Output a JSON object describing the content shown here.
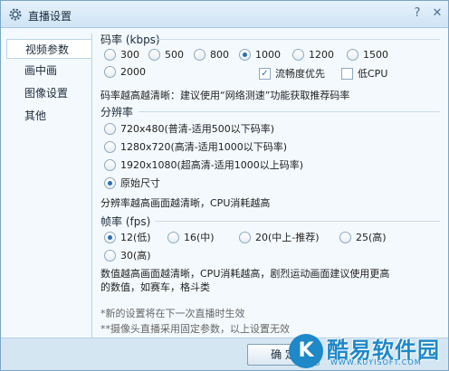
{
  "window": {
    "title": "直播设置",
    "help_glyph": "?",
    "close_glyph": "✕"
  },
  "sidebar": {
    "items": [
      {
        "label": "视频参数",
        "active": true
      },
      {
        "label": "画中画",
        "active": false
      },
      {
        "label": "图像设置",
        "active": false
      },
      {
        "label": "其他",
        "active": false
      }
    ]
  },
  "bitrate": {
    "title": "码率 (kbps)",
    "options": [
      "300",
      "500",
      "800",
      "1000",
      "1200",
      "1500",
      "2000"
    ],
    "selected": "1000",
    "smooth_label": "流畅度优先",
    "smooth_checked": true,
    "low_cpu_label": "低CPU",
    "low_cpu_checked": false,
    "hint": "码率越高越清晰：建议使用“网络测速”功能获取推荐码率"
  },
  "resolution": {
    "title": "分辨率",
    "options": [
      "720x480(普清-适用500以下码率)",
      "1280x720(高清-适用1000以下码率)",
      "1920x1080(超高清-适用1000以上码率)",
      "原始尺寸"
    ],
    "selected": "原始尺寸",
    "hint": "分辨率越高画面越清晰，CPU消耗越高"
  },
  "framerate": {
    "title": "帧率 (fps)",
    "options": [
      "12(低)",
      "16(中)",
      "20(中上-推荐)",
      "25(高)",
      "30(高)"
    ],
    "selected": "12(低)",
    "hint_line1": "数值越高画面越清晰，CPU消耗越高，剧烈运动画面建议使用更高",
    "hint_line2": "的数值，如赛车，格斗类"
  },
  "notes": {
    "line1": "*新的设置将在下一次直播时生效",
    "line2": "**摄像头直播采用固定参数，以上设置无效"
  },
  "footer": {
    "ok_label": "确 定"
  },
  "watermark": {
    "badge_letter": "K",
    "text": "酷易软件园",
    "url": "WWW.KUYISOFT.COM"
  },
  "colors": {
    "accent": "#2a6fb3",
    "titlebar": "#cfe4f4",
    "watermark": "#1e88c8"
  }
}
